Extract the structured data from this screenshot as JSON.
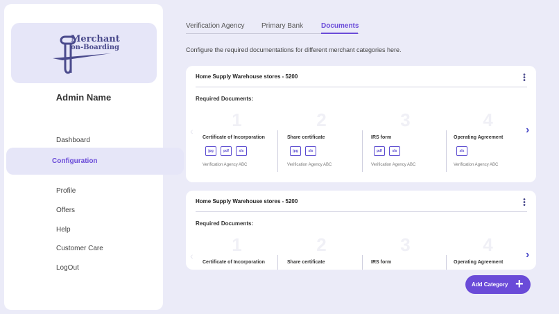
{
  "brand": {
    "line1": "Merchant",
    "line2": "on-Boarding"
  },
  "admin_name": "Admin Name",
  "nav": {
    "dashboard": "Dashboard",
    "configuration": "Configuration",
    "profile": "Profile",
    "offers": "Offers",
    "help": "Help",
    "customer_care": "Customer Care",
    "logout": "LogOut"
  },
  "tabs": [
    "Verification Agency",
    "Primary Bank",
    "Documents"
  ],
  "active_tab": "Documents",
  "intro": "Configure the required documentations for different merchant categories here.",
  "cards": [
    {
      "title": "Home Supply Warehouse stores - 5200",
      "required_label": "Required Documents:",
      "docs": [
        {
          "num": "1",
          "title": "Certificate of Incorporation",
          "formats": [
            "jpg",
            "pdf",
            "xls"
          ],
          "agency": "Verification Agency ABC"
        },
        {
          "num": "2",
          "title": "Share certificate",
          "formats": [
            "jpg",
            "xls"
          ],
          "agency": "Verification Agency ABC"
        },
        {
          "num": "3",
          "title": "IRS form",
          "formats": [
            "pdf",
            "xls"
          ],
          "agency": "Verification Agency ABC"
        },
        {
          "num": "4",
          "title": "Operating Agreement",
          "formats": [
            "xls"
          ],
          "agency": "Verification Agency ABC"
        }
      ]
    },
    {
      "title": "Home Supply Warehouse stores - 5200",
      "required_label": "Required Documents:",
      "docs": [
        {
          "num": "1",
          "title": "Certificate of Incorporation"
        },
        {
          "num": "2",
          "title": "Share certificate"
        },
        {
          "num": "3",
          "title": "IRS form"
        },
        {
          "num": "4",
          "title": "Operating Agreement"
        }
      ]
    }
  ],
  "add_category": "Add Category",
  "colors": {
    "accent": "#6a4bd8",
    "background": "#ebebf8",
    "highlight": "#e6e6f8"
  }
}
